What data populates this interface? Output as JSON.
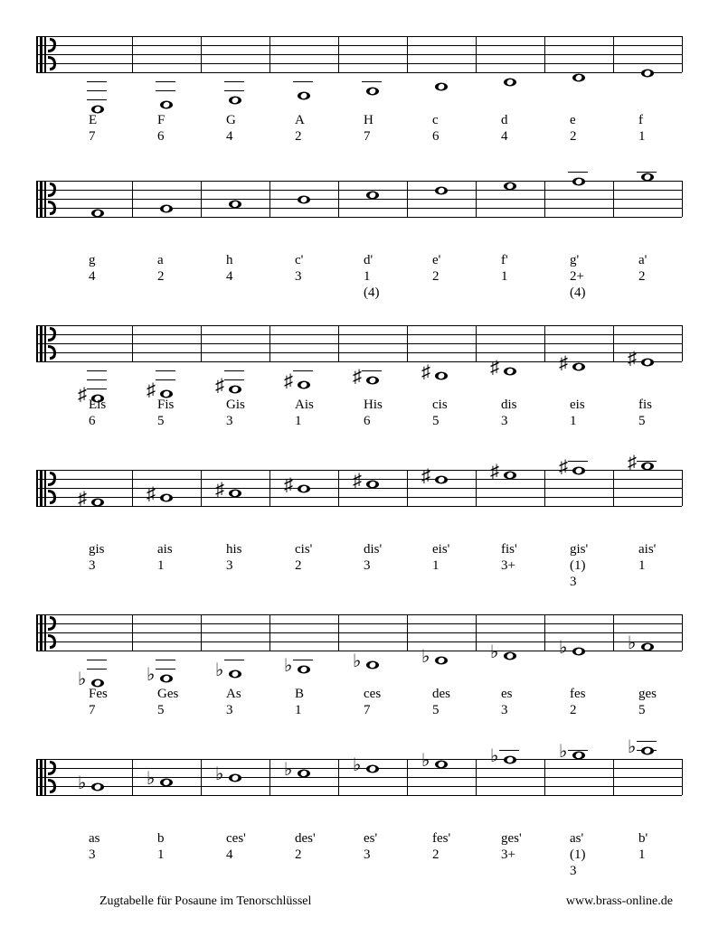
{
  "footer": {
    "title": "Zugtabelle für Posaune im Tenorschlüssel",
    "url": "www.brass-online.de"
  },
  "rows": [
    {
      "labelTop": 85,
      "notes": [
        {
          "name": "E",
          "pos": "7",
          "y": 70,
          "acc": null,
          "ledger": [
            50,
            60,
            70
          ]
        },
        {
          "name": "F",
          "pos": "6",
          "y": 65,
          "acc": null,
          "ledger": [
            50,
            60
          ]
        },
        {
          "name": "G",
          "pos": "4",
          "y": 60,
          "acc": null,
          "ledger": [
            50,
            60
          ]
        },
        {
          "name": "A",
          "pos": "2",
          "y": 55,
          "acc": null,
          "ledger": [
            50
          ]
        },
        {
          "name": "H",
          "pos": "7",
          "y": 50,
          "acc": null,
          "ledger": [
            50
          ]
        },
        {
          "name": "c",
          "pos": "6",
          "y": 45,
          "acc": null,
          "ledger": []
        },
        {
          "name": "d",
          "pos": "4",
          "y": 40,
          "acc": null,
          "ledger": []
        },
        {
          "name": "e",
          "pos": "2",
          "y": 35,
          "acc": null,
          "ledger": []
        },
        {
          "name": "f",
          "pos": "1",
          "y": 30,
          "acc": null,
          "ledger": []
        }
      ]
    },
    {
      "labelTop": 80,
      "notes": [
        {
          "name": "g",
          "pos": "4",
          "y": 25,
          "acc": null,
          "ledger": []
        },
        {
          "name": "a",
          "pos": "2",
          "y": 20,
          "acc": null,
          "ledger": []
        },
        {
          "name": "h",
          "pos": "4",
          "y": 15,
          "acc": null,
          "ledger": []
        },
        {
          "name": "c'",
          "pos": "3",
          "y": 10,
          "acc": null,
          "ledger": []
        },
        {
          "name": "d'",
          "pos": "1",
          "pos2": "(4)",
          "y": 5,
          "acc": null,
          "ledger": []
        },
        {
          "name": "e'",
          "pos": "2",
          "y": 0,
          "acc": null,
          "ledger": []
        },
        {
          "name": "f'",
          "pos": "1",
          "y": -5,
          "acc": null,
          "ledger": []
        },
        {
          "name": "g'",
          "pos": "2+",
          "pos2": "(4)",
          "y": -10,
          "acc": null,
          "ledger": [
            -10
          ]
        },
        {
          "name": "a'",
          "pos": "2",
          "y": -15,
          "acc": null,
          "ledger": [
            -10
          ]
        }
      ]
    },
    {
      "labelTop": 80,
      "notes": [
        {
          "name": "Eis",
          "pos": "6",
          "y": 70,
          "acc": "♯",
          "ledger": [
            50,
            60,
            70
          ]
        },
        {
          "name": "Fis",
          "pos": "5",
          "y": 65,
          "acc": "♯",
          "ledger": [
            50,
            60
          ]
        },
        {
          "name": "Gis",
          "pos": "3",
          "y": 60,
          "acc": "♯",
          "ledger": [
            50,
            60
          ]
        },
        {
          "name": "Ais",
          "pos": "1",
          "y": 55,
          "acc": "♯",
          "ledger": [
            50
          ]
        },
        {
          "name": "His",
          "pos": "6",
          "y": 50,
          "acc": "♯",
          "ledger": [
            50
          ]
        },
        {
          "name": "cis",
          "pos": "5",
          "y": 45,
          "acc": "♯",
          "ledger": []
        },
        {
          "name": "dis",
          "pos": "3",
          "y": 40,
          "acc": "♯",
          "ledger": []
        },
        {
          "name": "eis",
          "pos": "1",
          "y": 35,
          "acc": "♯",
          "ledger": []
        },
        {
          "name": "fis",
          "pos": "5",
          "y": 30,
          "acc": "♯",
          "ledger": []
        }
      ]
    },
    {
      "labelTop": 80,
      "notes": [
        {
          "name": "gis",
          "pos": "3",
          "y": 25,
          "acc": "♯",
          "ledger": []
        },
        {
          "name": "ais",
          "pos": "1",
          "y": 20,
          "acc": "♯",
          "ledger": []
        },
        {
          "name": "his",
          "pos": "3",
          "y": 15,
          "acc": "♯",
          "ledger": []
        },
        {
          "name": "cis'",
          "pos": "2",
          "y": 10,
          "acc": "♯",
          "ledger": []
        },
        {
          "name": "dis'",
          "pos": "3",
          "y": 5,
          "acc": "♯",
          "ledger": []
        },
        {
          "name": "eis'",
          "pos": "1",
          "y": 0,
          "acc": "♯",
          "ledger": []
        },
        {
          "name": "fis'",
          "pos": "3+",
          "y": -5,
          "acc": "♯",
          "ledger": []
        },
        {
          "name": "gis'",
          "pos": "(1)",
          "pos2": "3",
          "y": -10,
          "acc": "♯",
          "ledger": [
            -10
          ]
        },
        {
          "name": "ais'",
          "pos": "1",
          "y": -15,
          "acc": "♯",
          "ledger": [
            -10
          ]
        }
      ]
    },
    {
      "labelTop": 80,
      "notes": [
        {
          "name": "Fes",
          "pos": "7",
          "y": 65,
          "acc": "♭",
          "ledger": [
            50,
            60
          ]
        },
        {
          "name": "Ges",
          "pos": "5",
          "y": 60,
          "acc": "♭",
          "ledger": [
            50,
            60
          ]
        },
        {
          "name": "As",
          "pos": "3",
          "y": 55,
          "acc": "♭",
          "ledger": [
            50
          ]
        },
        {
          "name": "B",
          "pos": "1",
          "y": 50,
          "acc": "♭",
          "ledger": [
            50
          ]
        },
        {
          "name": "ces",
          "pos": "7",
          "y": 45,
          "acc": "♭",
          "ledger": []
        },
        {
          "name": "des",
          "pos": "5",
          "y": 40,
          "acc": "♭",
          "ledger": []
        },
        {
          "name": "es",
          "pos": "3",
          "y": 35,
          "acc": "♭",
          "ledger": []
        },
        {
          "name": "fes",
          "pos": "2",
          "y": 30,
          "acc": "♭",
          "ledger": []
        },
        {
          "name": "ges",
          "pos": "5",
          "y": 25,
          "acc": "♭",
          "ledger": []
        }
      ]
    },
    {
      "labelTop": 80,
      "notes": [
        {
          "name": "as",
          "pos": "3",
          "y": 20,
          "acc": "♭",
          "ledger": []
        },
        {
          "name": "b",
          "pos": "1",
          "y": 15,
          "acc": "♭",
          "ledger": []
        },
        {
          "name": "ces'",
          "pos": "4",
          "y": 10,
          "acc": "♭",
          "ledger": []
        },
        {
          "name": "des'",
          "pos": "2",
          "y": 5,
          "acc": "♭",
          "ledger": []
        },
        {
          "name": "es'",
          "pos": "3",
          "y": 0,
          "acc": "♭",
          "ledger": []
        },
        {
          "name": "fes'",
          "pos": "2",
          "y": -5,
          "acc": "♭",
          "ledger": []
        },
        {
          "name": "ges'",
          "pos": "3+",
          "y": -10,
          "acc": "♭",
          "ledger": [
            -10
          ]
        },
        {
          "name": "as'",
          "pos": "(1)",
          "pos2": "3",
          "y": -15,
          "acc": "♭",
          "ledger": [
            -10
          ]
        },
        {
          "name": "b'",
          "pos": "1",
          "y": -20,
          "acc": "♭",
          "ledger": [
            -10,
            -20
          ]
        }
      ]
    }
  ]
}
